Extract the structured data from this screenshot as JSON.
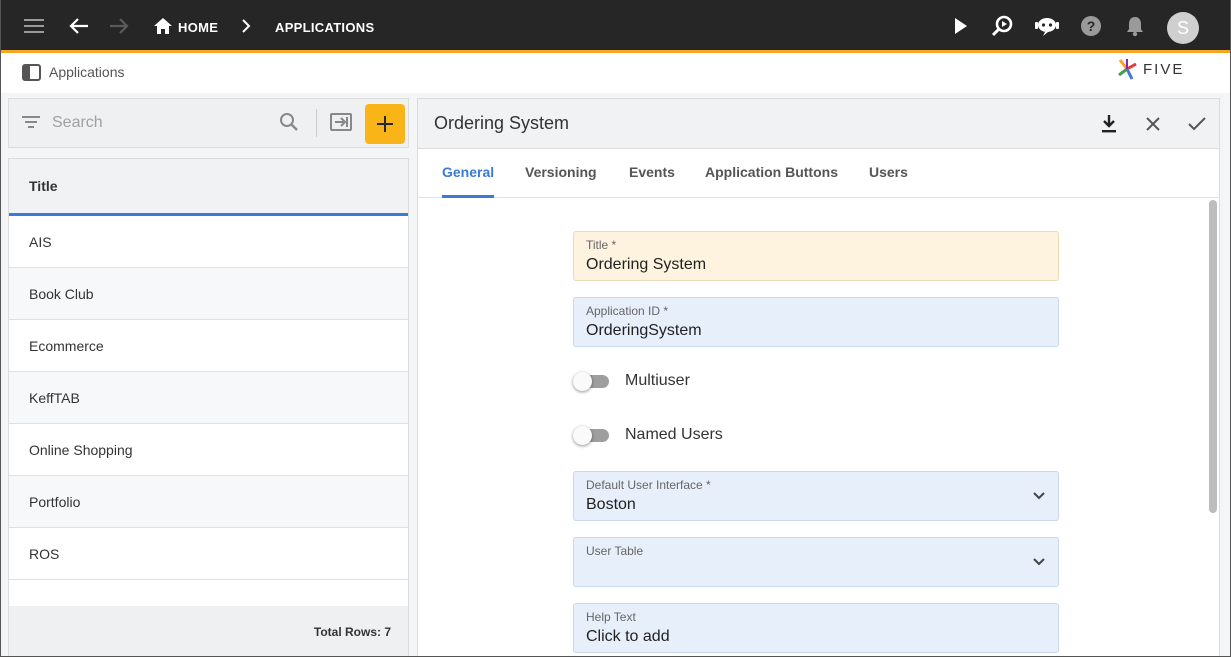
{
  "topbar": {
    "home_label": "HOME",
    "applications_label": "APPLICATIONS",
    "avatar_letter": "S"
  },
  "subheader": {
    "breadcrumb": "Applications",
    "logo_text": "FIVE"
  },
  "search": {
    "placeholder": "Search"
  },
  "list": {
    "column_header": "Title",
    "rows": [
      "AIS",
      "Book Club",
      "Ecommerce",
      "KeffTAB",
      "Online Shopping",
      "Portfolio",
      "ROS"
    ],
    "footer": "Total Rows: 7"
  },
  "detail": {
    "title": "Ordering System",
    "tabs": [
      "General",
      "Versioning",
      "Events",
      "Application Buttons",
      "Users"
    ],
    "active_tab": "General",
    "fields": {
      "title": {
        "label": "Title *",
        "value": "Ordering System"
      },
      "application_id": {
        "label": "Application ID *",
        "value": "OrderingSystem"
      },
      "multiuser": {
        "label": "Multiuser",
        "checked": false
      },
      "named_users": {
        "label": "Named Users",
        "checked": false
      },
      "default_ui": {
        "label": "Default User Interface *",
        "value": "Boston"
      },
      "user_table": {
        "label": "User Table",
        "value": ""
      },
      "help_text": {
        "label": "Help Text",
        "value": "Click to add"
      }
    }
  },
  "colors": {
    "topbar_bg": "#262626",
    "accent_orange": "#f9b418",
    "accent_blue": "#3a7bd5",
    "required_field_bg": "#fdf3de",
    "field_bg": "#e6effa"
  },
  "icons": [
    "menu-icon",
    "back-arrow-icon",
    "forward-arrow-icon",
    "home-icon",
    "chevron-right-icon",
    "play-icon",
    "search-gear-icon",
    "chat-bot-icon",
    "help-icon",
    "bell-icon",
    "sidebar-toggle-icon",
    "filter-icon",
    "search-icon",
    "export-icon",
    "plus-icon",
    "download-icon",
    "close-icon",
    "check-icon",
    "chevron-down-icon"
  ]
}
